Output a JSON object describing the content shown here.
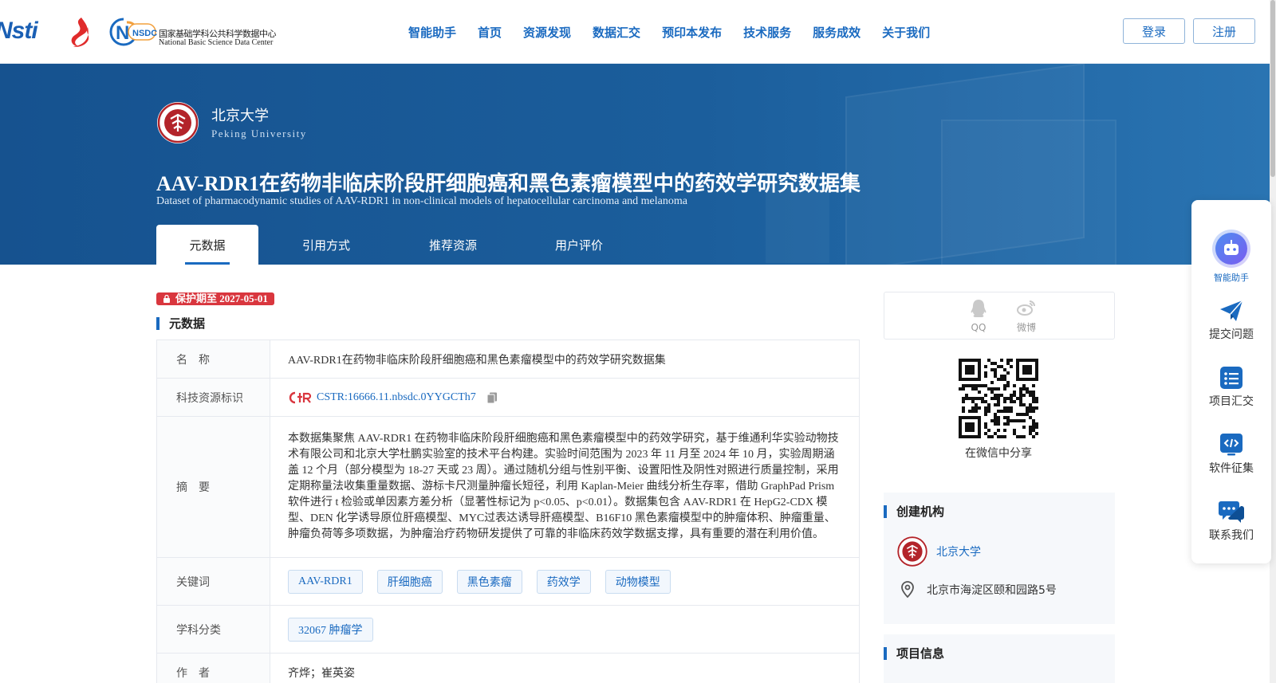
{
  "header": {
    "logo_nstl_text": "Nsti",
    "logo_nsdc_abbr": "NSDC",
    "logo_nsdc_cn": "国家基础学科公共科学数据中心",
    "logo_nsdc_en": "National Basic Science Data Center",
    "nav": [
      "智能助手",
      "首页",
      "资源发现",
      "数据汇交",
      "预印本发布",
      "技术服务",
      "服务成效",
      "关于我们"
    ],
    "login": "登录",
    "register": "注册"
  },
  "banner": {
    "institution_cn": "北京大学",
    "institution_en": "Peking University",
    "title": "AAV-RDR1在药物非临床阶段肝细胞癌和黑色素瘤模型中的药效学研究数据集",
    "title_en": "Dataset of pharmacodynamic studies of AAV-RDR1 in non-clinical models of hepatocellular carcinoma and melanoma",
    "tabs": [
      "元数据",
      "引用方式",
      "推荐资源",
      "用户评价"
    ],
    "active_tab": 0
  },
  "main": {
    "protection_badge": "保护期至 2027-05-01",
    "section_title": "元数据",
    "rows": {
      "name": {
        "key": "名　称",
        "value": "AAV-RDR1在药物非临床阶段肝细胞癌和黑色素瘤模型中的药效学研究数据集"
      },
      "cstr": {
        "key": "科技资源标识",
        "value": "CSTR:16666.11.nbsdc.0YYGCTh7"
      },
      "abstract": {
        "key": "摘　要",
        "value": "本数据集聚焦 AAV-RDR1 在药物非临床阶段肝细胞癌和黑色素瘤模型中的药效学研究，基于维通利华实验动物技术有限公司和北京大学杜鹏实验室的技术平台构建。实验时间范围为 2023 年 11 月至 2024 年 10 月，实验周期涵盖 12 个月（部分模型为 18-27 天或 23 周）。通过随机分组与性别平衡、设置阳性及阴性对照进行质量控制，采用定期称量法收集重量数据、游标卡尺测量肿瘤长短径，利用 Kaplan-Meier 曲线分析生存率，借助 GraphPad Prism 软件进行 t 检验或单因素方差分析（显著性标记为 p<0.05、p<0.01）。数据集包含 AAV-RDR1 在 HepG2-CDX 模型、DEN 化学诱导原位肝癌模型、MYC过表达诱导肝癌模型、B16F10 黑色素瘤模型中的肿瘤体积、肿瘤重量、肿瘤负荷等多项数据，为肿瘤治疗药物研发提供了可靠的非临床药效学数据支撑，具有重要的潜在利用价值。"
      },
      "keywords": {
        "key": "关键词",
        "values": [
          "AAV-RDR1",
          "肝细胞癌",
          "黑色素瘤",
          "药效学",
          "动物模型"
        ]
      },
      "subject": {
        "key": "学科分类",
        "values": [
          "32067 肿瘤学"
        ]
      },
      "authors": {
        "key": "作　者",
        "value": "齐烨；崔英姿"
      }
    }
  },
  "sidebar": {
    "share_qq": "QQ",
    "share_weibo": "微博",
    "qr_caption": "在微信中分享",
    "org_title": "创建机构",
    "org_name": "北京大学",
    "org_address": "北京市海淀区颐和园路5号",
    "project_title": "项目信息"
  },
  "float_bar": {
    "items": [
      "智能助手",
      "提交问题",
      "项目汇交",
      "软件征集",
      "联系我们"
    ]
  },
  "colors": {
    "primary": "#1a6ac0",
    "banner": "#1b5e9c",
    "badge": "#d9363e",
    "pku_red": "#b3242a"
  }
}
